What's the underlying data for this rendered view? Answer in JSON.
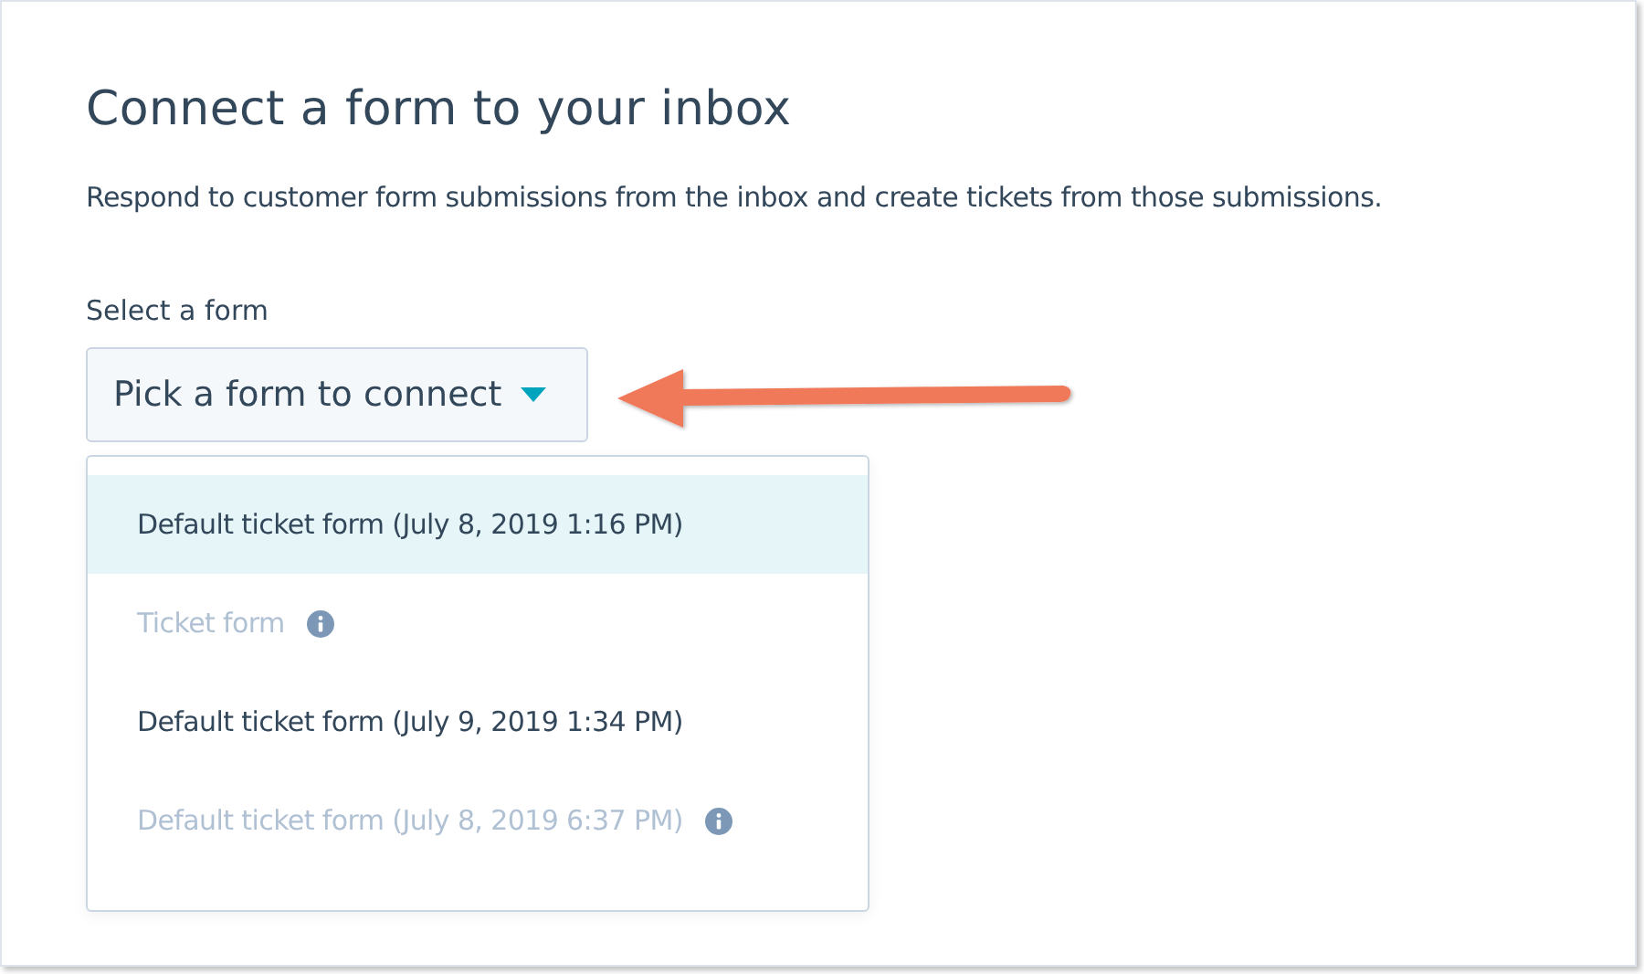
{
  "title": "Connect a form to your inbox",
  "description": "Respond to customer form submissions from the inbox and create tickets from those submissions.",
  "field": {
    "label": "Select a form",
    "placeholder": "Pick a form to connect",
    "expanded": true
  },
  "options": [
    {
      "label": "Default ticket form (July 8, 2019 1:16 PM)",
      "selected": true,
      "disabled": false,
      "info": false
    },
    {
      "label": "Ticket form",
      "selected": false,
      "disabled": true,
      "info": true
    },
    {
      "label": "Default ticket form (July 9, 2019 1:34 PM)",
      "selected": false,
      "disabled": false,
      "info": false
    },
    {
      "label": "Default ticket form (July 8, 2019 6:37 PM)",
      "selected": false,
      "disabled": true,
      "info": true
    }
  ]
}
